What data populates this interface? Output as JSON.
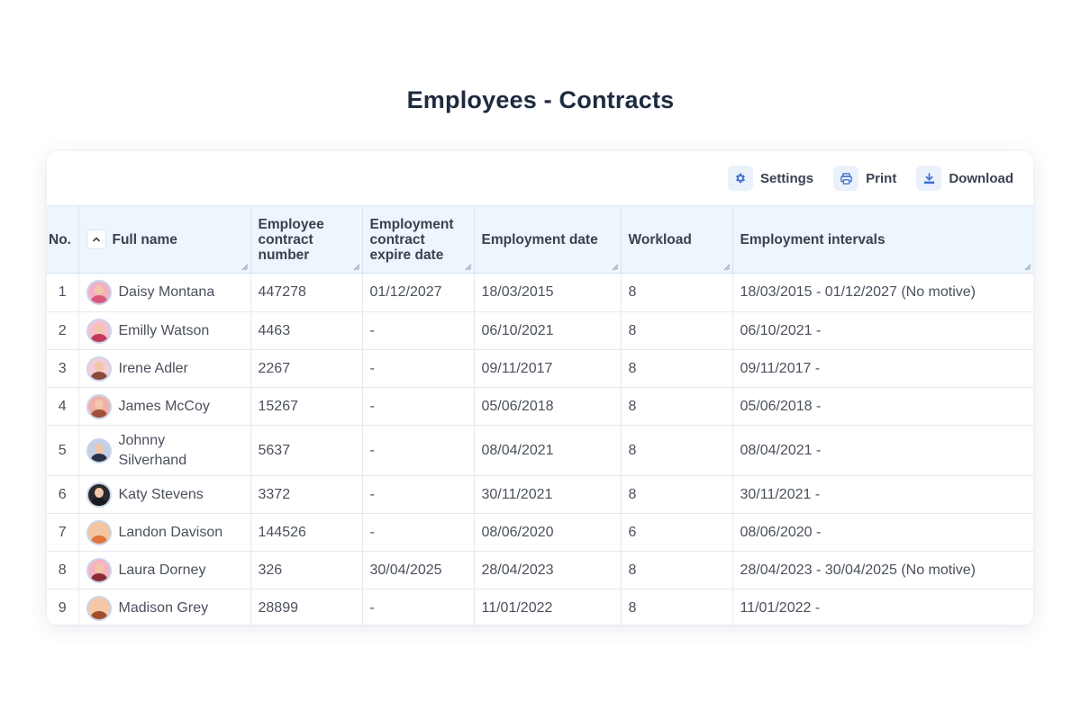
{
  "page": {
    "title": "Employees - Contracts"
  },
  "toolbar": {
    "settings": {
      "label": "Settings",
      "icon": "gear-icon"
    },
    "print": {
      "label": "Print",
      "icon": "printer-icon"
    },
    "download": {
      "label": "Download",
      "icon": "download-icon"
    }
  },
  "colors": {
    "accent": "#3b6fd1",
    "header_bg": "#edf5fd",
    "title": "#1d2a40"
  },
  "table": {
    "columns": [
      {
        "key": "no",
        "label": "No."
      },
      {
        "key": "name",
        "label": "Full name",
        "sort": "ascending"
      },
      {
        "key": "contract",
        "label": "Employee contract number"
      },
      {
        "key": "expire",
        "label": "Employment contract expire date"
      },
      {
        "key": "date",
        "label": "Employment date"
      },
      {
        "key": "workload",
        "label": "Workload"
      },
      {
        "key": "intervals",
        "label": "Employment intervals"
      }
    ],
    "rows": [
      {
        "no": "1",
        "name": "Daisy Montana",
        "contract": "447278",
        "expire": "01/12/2027",
        "date": "18/03/2015",
        "workload": "8",
        "intervals": "18/03/2015 - 01/12/2027 (No motive)",
        "avatar_bg": "#f3b0c4",
        "avatar_shirt": "#d9587e"
      },
      {
        "no": "2",
        "name": "Emilly Watson",
        "contract": "4463",
        "expire": "-",
        "date": "06/10/2021",
        "workload": "8",
        "intervals": "06/10/2021 -",
        "avatar_bg": "#f7c0cf",
        "avatar_shirt": "#c0395a"
      },
      {
        "no": "3",
        "name": "Irene Adler",
        "contract": "2267",
        "expire": "-",
        "date": "09/11/2017",
        "workload": "8",
        "intervals": "09/11/2017 -",
        "avatar_bg": "#f5cdd6",
        "avatar_shirt": "#8c4a3a"
      },
      {
        "no": "4",
        "name": "James McCoy",
        "contract": "15267",
        "expire": "-",
        "date": "05/06/2018",
        "workload": "8",
        "intervals": "05/06/2018 -",
        "avatar_bg": "#f0b0a8",
        "avatar_shirt": "#a0503c"
      },
      {
        "no": "5",
        "name": "Johnny Silverhand",
        "contract": "5637",
        "expire": "-",
        "date": "08/04/2021",
        "workload": "8",
        "intervals": "08/04/2021 -",
        "avatar_bg": "#c4cfe6",
        "avatar_shirt": "#2b3145"
      },
      {
        "no": "6",
        "name": "Katy Stevens",
        "contract": "3372",
        "expire": "-",
        "date": "30/11/2021",
        "workload": "8",
        "intervals": "30/11/2021 -",
        "avatar_bg": "#2a2a2e",
        "avatar_shirt": "#1a1a1e"
      },
      {
        "no": "7",
        "name": "Landon Davison",
        "contract": "144526",
        "expire": "-",
        "date": "08/06/2020",
        "workload": "6",
        "intervals": "08/06/2020 -",
        "avatar_bg": "#f8c49a",
        "avatar_shirt": "#e2763c"
      },
      {
        "no": "8",
        "name": "Laura Dorney",
        "contract": "326",
        "expire": "30/04/2025",
        "date": "28/04/2023",
        "workload": "8",
        "intervals": "28/04/2023 - 30/04/2025 (No motive)",
        "avatar_bg": "#f6b4c2",
        "avatar_shirt": "#8a2c36"
      },
      {
        "no": "9",
        "name": "Madison Grey",
        "contract": "28899",
        "expire": "-",
        "date": "11/01/2022",
        "workload": "8",
        "intervals": "11/01/2022 -",
        "avatar_bg": "#f6c8a6",
        "avatar_shirt": "#9e4e2a"
      }
    ]
  }
}
